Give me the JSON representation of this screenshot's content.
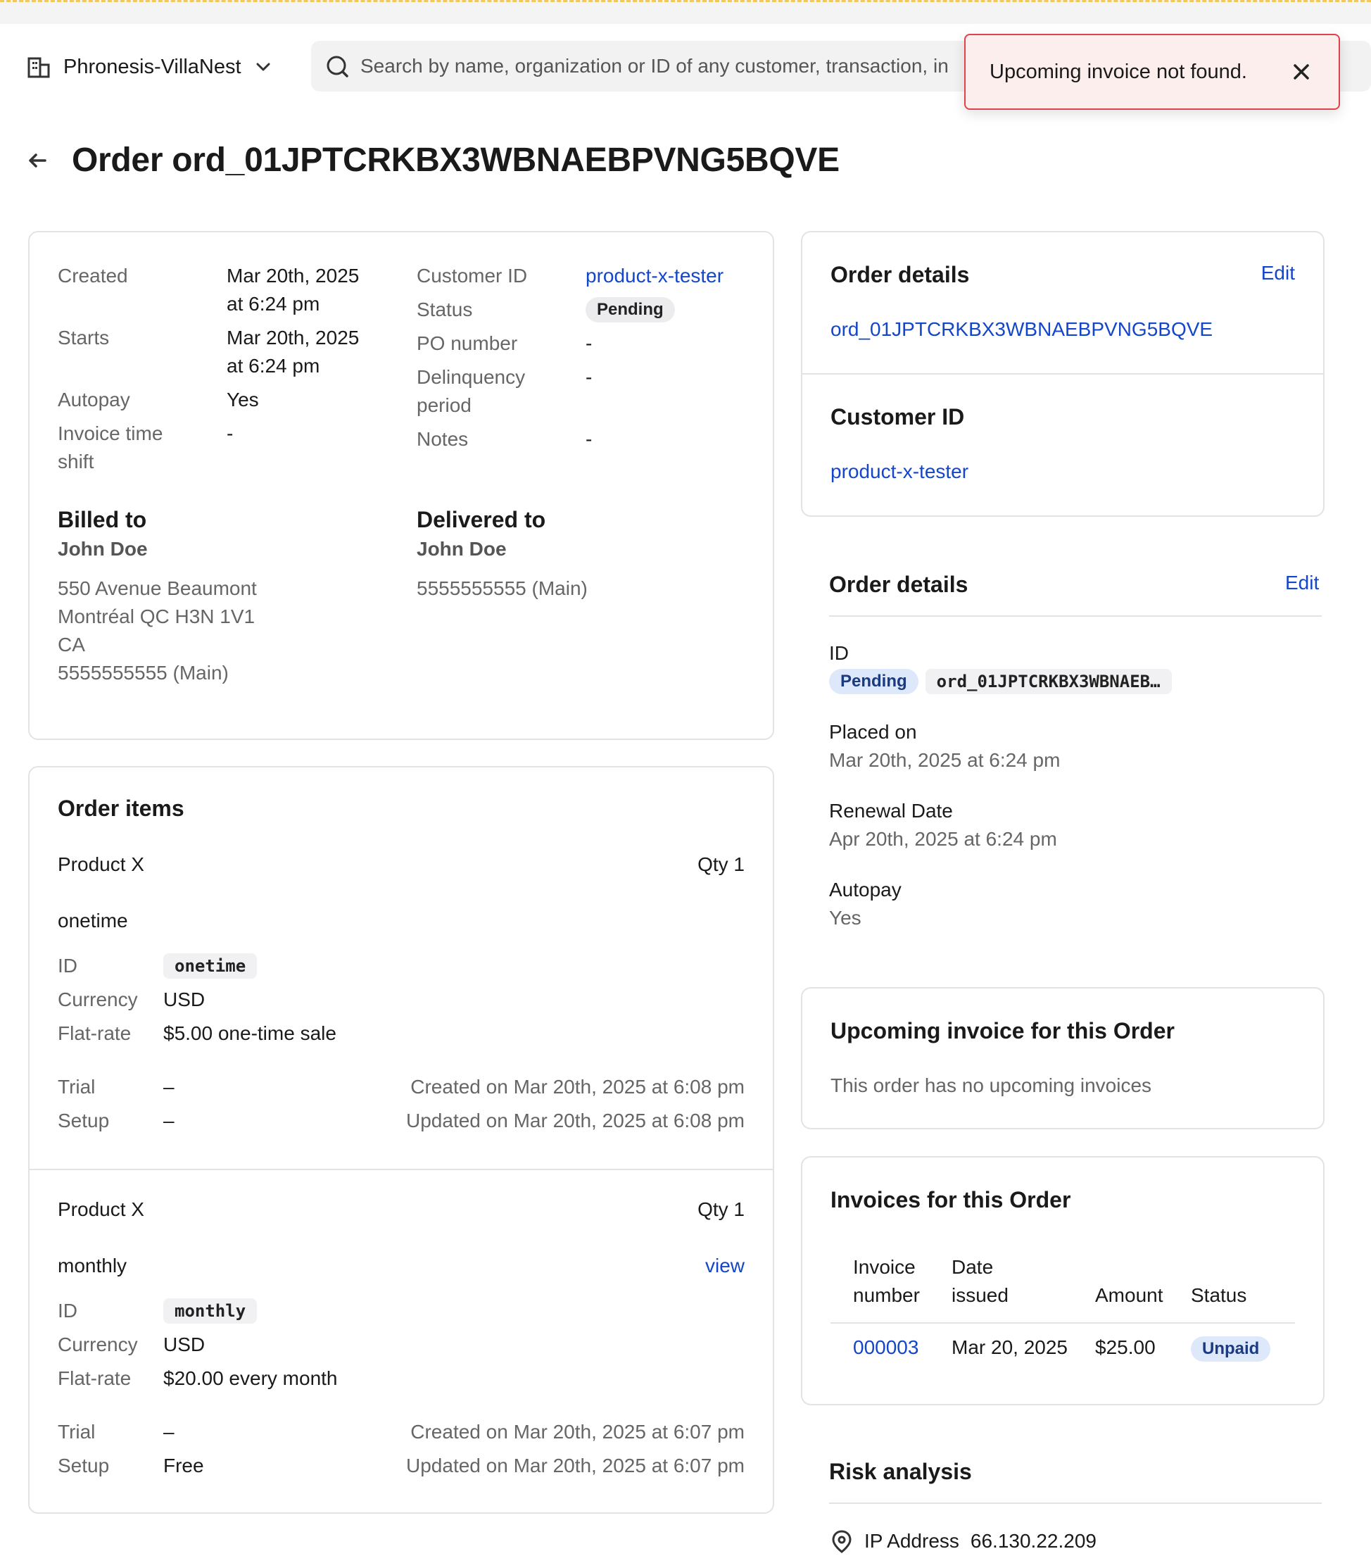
{
  "header": {
    "org_name": "Phronesis-VillaNest",
    "search_placeholder": "Search by name, organization or ID of any customer, transaction, in"
  },
  "toast": {
    "message": "Upcoming invoice not found."
  },
  "page": {
    "title": "Order ord_01JPTCRKBX3WBNAEBPVNG5BQVE"
  },
  "summary": {
    "created_label": "Created",
    "created_value_1": "Mar 20th, 2025",
    "created_value_2": "at 6:24 pm",
    "starts_label": "Starts",
    "starts_value_1": "Mar 20th, 2025",
    "starts_value_2": "at 6:24 pm",
    "autopay_label": "Autopay",
    "autopay_value": "Yes",
    "invoice_shift_label_1": "Invoice time",
    "invoice_shift_label_2": "shift",
    "invoice_shift_value": "-",
    "customer_id_label": "Customer ID",
    "customer_id_value": "product-x-tester",
    "status_label": "Status",
    "status_value": "Pending",
    "po_label": "PO number",
    "po_value": "-",
    "delinquency_label_1": "Delinquency",
    "delinquency_label_2": "period",
    "delinquency_value": "-",
    "notes_label": "Notes",
    "notes_value": "-",
    "billed_title": "Billed to",
    "billed_name": "John Doe",
    "billed_line1": "550 Avenue Beaumont",
    "billed_line2": "Montréal QC H3N 1V1",
    "billed_line3": "CA",
    "billed_phone": "5555555555 (Main)",
    "delivered_title": "Delivered to",
    "delivered_name": "John Doe",
    "delivered_phone": "5555555555 (Main)"
  },
  "order_items": {
    "title": "Order items",
    "items": [
      {
        "product": "Product X",
        "qty": "Qty 1",
        "plan": "onetime",
        "link": "",
        "id_label": "ID",
        "id_value": "onetime",
        "currency_label": "Currency",
        "currency_value": "USD",
        "flat_label": "Flat-rate",
        "flat_value": "$5.00 one-time sale",
        "trial_label": "Trial",
        "trial_value": "–",
        "setup_label": "Setup",
        "setup_value": "–",
        "created": "Created on Mar 20th, 2025 at 6:08 pm",
        "updated": "Updated on Mar 20th, 2025 at 6:08 pm"
      },
      {
        "product": "Product X",
        "qty": "Qty 1",
        "plan": "monthly",
        "link": "view",
        "id_label": "ID",
        "id_value": "monthly",
        "currency_label": "Currency",
        "currency_value": "USD",
        "flat_label": "Flat-rate",
        "flat_value": "$20.00 every month",
        "trial_label": "Trial",
        "trial_value": "–",
        "setup_label": "Setup",
        "setup_value": "Free",
        "created": "Created on Mar 20th, 2025 at 6:07 pm",
        "updated": "Updated on Mar 20th, 2025 at 6:07 pm"
      }
    ]
  },
  "order_details_card": {
    "title": "Order details",
    "edit_label": "Edit",
    "order_id": "ord_01JPTCRKBX3WBNAEBPVNG5BQVE",
    "customer_title": "Customer ID",
    "customer_value": "product-x-tester"
  },
  "order_details_panel": {
    "title": "Order details",
    "edit_label": "Edit",
    "id_label": "ID",
    "status": "Pending",
    "id_chip": "ord_01JPTCRKBX3WBNAEB…",
    "placed_label": "Placed on",
    "placed_value": "Mar 20th, 2025 at 6:24 pm",
    "renewal_label": "Renewal Date",
    "renewal_value": "Apr 20th, 2025 at 6:24 pm",
    "autopay_label": "Autopay",
    "autopay_value": "Yes"
  },
  "upcoming": {
    "title": "Upcoming invoice for this Order",
    "empty_text": "This order has no upcoming invoices"
  },
  "invoices": {
    "title": "Invoices for this Order",
    "col_number_1": "Invoice",
    "col_number_2": "number",
    "col_date_1": "Date",
    "col_date_2": "issued",
    "col_amount": "Amount",
    "col_status": "Status",
    "rows": [
      {
        "number": "000003",
        "date": "Mar 20, 2025",
        "amount": "$25.00",
        "status": "Unpaid"
      }
    ]
  },
  "risk": {
    "title": "Risk analysis",
    "ip_label": "IP Address",
    "ip_value": "66.130.22.209"
  },
  "colors": {
    "link": "#1446c9",
    "toast_border": "#e0424c",
    "toast_bg": "#fdeeee",
    "warning_strip": "#f0c95a"
  },
  "icons": [
    "building-icon",
    "chevron-down-icon",
    "search-icon",
    "close-icon",
    "arrow-left-icon",
    "location-pin-icon"
  ]
}
